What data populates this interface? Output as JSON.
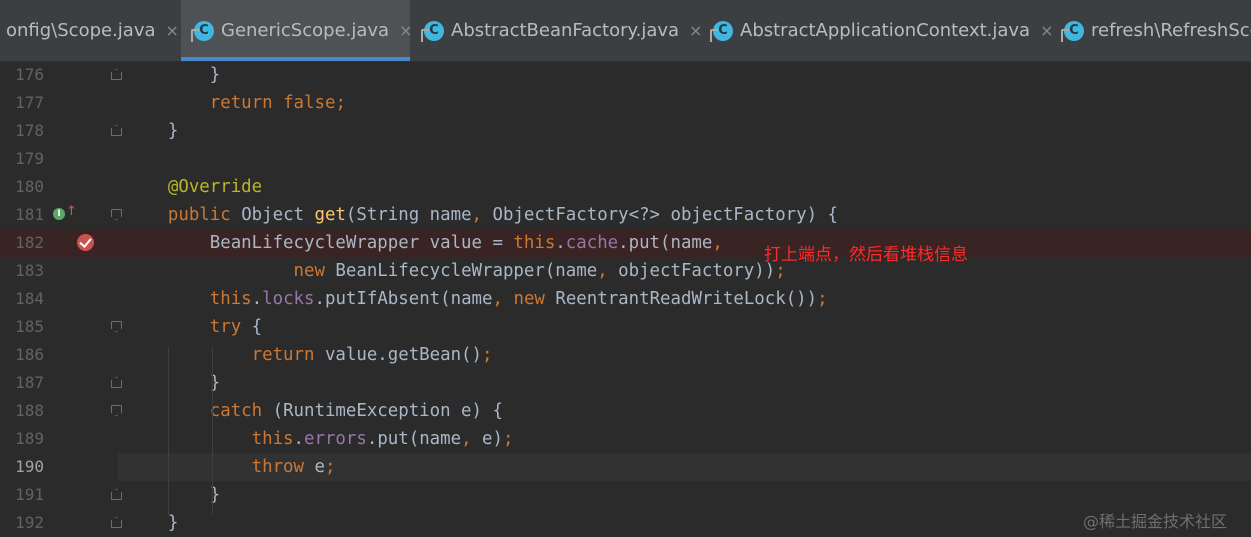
{
  "tabs": [
    {
      "label": "onfig\\Scope.java",
      "active": false,
      "icon": "none"
    },
    {
      "label": "GenericScope.java",
      "active": true,
      "icon": "class-icon"
    },
    {
      "label": "AbstractBeanFactory.java",
      "active": false,
      "icon": "class-icon"
    },
    {
      "label": "AbstractApplicationContext.java",
      "active": false,
      "icon": "class-icon"
    },
    {
      "label": "refresh\\RefreshSco",
      "active": false,
      "icon": "class-icon"
    }
  ],
  "tab_close_glyph": "×",
  "class_icon_letter": "C",
  "lines": [
    {
      "num": "176",
      "tokens": [
        {
          "t": "        }",
          "c": ""
        }
      ]
    },
    {
      "num": "177",
      "tokens": [
        {
          "t": "        ",
          "c": ""
        },
        {
          "t": "return",
          "c": "kw"
        },
        {
          "t": " ",
          "c": ""
        },
        {
          "t": "false",
          "c": "kw"
        },
        {
          "t": ";",
          "c": "kw"
        }
      ]
    },
    {
      "num": "178",
      "tokens": [
        {
          "t": "    }",
          "c": ""
        }
      ]
    },
    {
      "num": "179",
      "tokens": []
    },
    {
      "num": "180",
      "tokens": [
        {
          "t": "    @Override",
          "c": "ann"
        }
      ]
    },
    {
      "num": "181",
      "tokens": [
        {
          "t": "    ",
          "c": ""
        },
        {
          "t": "public",
          "c": "kw"
        },
        {
          "t": " Object ",
          "c": ""
        },
        {
          "t": "get",
          "c": "fn"
        },
        {
          "t": "(String name",
          "c": ""
        },
        {
          "t": ",",
          "c": "kw"
        },
        {
          "t": " ObjectFactory<?> objectFactory) {",
          "c": ""
        }
      ]
    },
    {
      "num": "182",
      "tokens": [
        {
          "t": "        BeanLifecycleWrapper value = ",
          "c": ""
        },
        {
          "t": "this",
          "c": "kw"
        },
        {
          "t": ".",
          "c": ""
        },
        {
          "t": "cache",
          "c": "fld"
        },
        {
          "t": ".put(name",
          "c": ""
        },
        {
          "t": ",",
          "c": "kw"
        }
      ]
    },
    {
      "num": "183",
      "tokens": [
        {
          "t": "                ",
          "c": ""
        },
        {
          "t": "new",
          "c": "kw"
        },
        {
          "t": " BeanLifecycleWrapper(name",
          "c": ""
        },
        {
          "t": ",",
          "c": "kw"
        },
        {
          "t": " objectFactory))",
          "c": ""
        },
        {
          "t": ";",
          "c": "kw"
        }
      ]
    },
    {
      "num": "184",
      "tokens": [
        {
          "t": "        ",
          "c": ""
        },
        {
          "t": "this",
          "c": "kw"
        },
        {
          "t": ".",
          "c": ""
        },
        {
          "t": "locks",
          "c": "fld"
        },
        {
          "t": ".putIfAbsent(name",
          "c": ""
        },
        {
          "t": ",",
          "c": "kw"
        },
        {
          "t": " ",
          "c": ""
        },
        {
          "t": "new",
          "c": "kw"
        },
        {
          "t": " ReentrantReadWriteLock())",
          "c": ""
        },
        {
          "t": ";",
          "c": "kw"
        }
      ]
    },
    {
      "num": "185",
      "tokens": [
        {
          "t": "        ",
          "c": ""
        },
        {
          "t": "try",
          "c": "kw"
        },
        {
          "t": " {",
          "c": ""
        }
      ]
    },
    {
      "num": "186",
      "tokens": [
        {
          "t": "            ",
          "c": ""
        },
        {
          "t": "return",
          "c": "kw"
        },
        {
          "t": " value.getBean()",
          "c": ""
        },
        {
          "t": ";",
          "c": "kw"
        }
      ]
    },
    {
      "num": "187",
      "tokens": [
        {
          "t": "        }",
          "c": ""
        }
      ]
    },
    {
      "num": "188",
      "tokens": [
        {
          "t": "        ",
          "c": ""
        },
        {
          "t": "catch",
          "c": "kw"
        },
        {
          "t": " (RuntimeException e) {",
          "c": ""
        }
      ]
    },
    {
      "num": "189",
      "tokens": [
        {
          "t": "            ",
          "c": ""
        },
        {
          "t": "this",
          "c": "kw"
        },
        {
          "t": ".",
          "c": ""
        },
        {
          "t": "errors",
          "c": "fld"
        },
        {
          "t": ".put(name",
          "c": ""
        },
        {
          "t": ",",
          "c": "kw"
        },
        {
          "t": " e)",
          "c": ""
        },
        {
          "t": ";",
          "c": "kw"
        }
      ]
    },
    {
      "num": "190",
      "tokens": [
        {
          "t": "            ",
          "c": ""
        },
        {
          "t": "throw",
          "c": "kw"
        },
        {
          "t": " e",
          "c": ""
        },
        {
          "t": ";",
          "c": "kw"
        }
      ]
    },
    {
      "num": "191",
      "tokens": [
        {
          "t": "        }",
          "c": ""
        }
      ]
    },
    {
      "num": "192",
      "tokens": [
        {
          "t": "    }",
          "c": ""
        }
      ]
    }
  ],
  "annotation_text": "打上端点，然后看堆栈信息",
  "watermark": "@稀土掘金技术社区",
  "gutter_icons": {
    "implements": "I",
    "implements_arrow": "↑"
  },
  "colors": {
    "background": "#2b2b2b",
    "keyword": "#cc7832",
    "annotation": "#bbb529",
    "field": "#9876aa",
    "method": "#ffc66d",
    "text": "#a9b7c6",
    "breakpoint": "#c75450",
    "note": "#ff2a2a"
  }
}
